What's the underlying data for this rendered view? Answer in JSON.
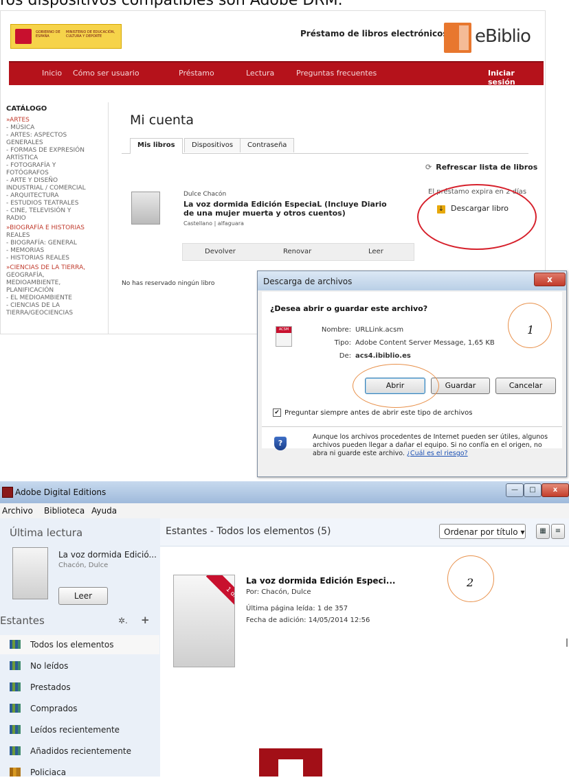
{
  "caption": "ros dispositivos compatibles son Adobe DRM.",
  "web": {
    "gov": {
      "line1": "GOBIERNO DE ESPAÑA",
      "line2": "MINISTERIO DE EDUCACIÓN, CULTURA Y DEPORTE"
    },
    "header_title": "Préstamo de libros electrónicos",
    "brand": "eBiblio",
    "nav": [
      "Inicio",
      "Cómo ser usuario",
      "Préstamo",
      "Lectura",
      "Preguntas frecuentes"
    ],
    "login": "Iniciar sesión",
    "catalog": {
      "heading": "CATÁLOGO",
      "items": [
        {
          "label": "»ARTES",
          "cat": true
        },
        {
          "label": "- MÚSICA"
        },
        {
          "label": "- ARTES: ASPECTOS"
        },
        {
          "label": "GENERALES"
        },
        {
          "label": "- FORMAS DE EXPRESIÓN"
        },
        {
          "label": "ARTÍSTICA"
        },
        {
          "label": "- FOTOGRAFÍA Y"
        },
        {
          "label": "FOTÓGRAFOS"
        },
        {
          "label": "- ARTE Y DISEÑO"
        },
        {
          "label": "INDUSTRIAL / COMERCIAL"
        },
        {
          "label": "- ARQUITECTURA"
        },
        {
          "label": "- ESTUDIOS TEATRALES"
        },
        {
          "label": "- CINE, TELEVISIÓN Y"
        },
        {
          "label": "RADIO"
        },
        {
          "label": "»BIOGRAFÍA E HISTORIAS",
          "cat": true
        },
        {
          "label": "REALES"
        },
        {
          "label": "- BIOGRAFÍA: GENERAL"
        },
        {
          "label": "- MEMORIAS"
        },
        {
          "label": "- HISTORIAS REALES"
        },
        {
          "label": "»CIENCIAS DE LA TIERRA,",
          "cat": true
        },
        {
          "label": "GEOGRAFÍA,"
        },
        {
          "label": "MEDIOAMBIENTE,"
        },
        {
          "label": "PLANIFICACIÓN"
        },
        {
          "label": "- EL MEDIOAMBIENTE"
        },
        {
          "label": "- CIENCIAS DE LA"
        },
        {
          "label": "TIERRA/GEOCIENCIAS"
        }
      ]
    },
    "page_title": "Mi cuenta",
    "tabs": [
      "Mis libros",
      "Dispositivos",
      "Contraseña"
    ],
    "refresh": "Refrescar lista de libros",
    "book": {
      "author": "Dulce Chacón",
      "title": "La voz dormida Edición EspeciaL (Incluye Diario de una mujer muerta y otros cuentos)",
      "lang": "Castellano | alfaguara"
    },
    "expire": "El préstamo expira en 2 días",
    "download": "Descargar libro",
    "actions": [
      "Devolver",
      "Renovar",
      "Leer"
    ],
    "no_reserve": "No has reservado ningún libro"
  },
  "dialog": {
    "title": "Descarga de archivos",
    "close": "x",
    "question": "¿Desea abrir o guardar este archivo?",
    "file_tag": "ACSM",
    "labels": {
      "name": "Nombre:",
      "type": "Tipo:",
      "from": "De:"
    },
    "values": {
      "name": "URLLink.acsm",
      "type": "Adobe Content Server Message, 1,65 KB",
      "from": "acs4.ibiblio.es"
    },
    "buttons": {
      "open": "Abrir",
      "save": "Guardar",
      "cancel": "Cancelar"
    },
    "checkbox": "Preguntar siempre antes de abrir este tipo de archivos",
    "warning": "Aunque los archivos procedentes de Internet pueden ser útiles, algunos archivos pueden llegar a dañar el equipo. Si no confía en el origen, no abra ni guarde este archivo.",
    "risk_link": "¿Cuál es el riesgo?",
    "marker": "1"
  },
  "ade": {
    "title": "Adobe Digital Editions",
    "menu": [
      "Archivo",
      "Biblioteca",
      "Ayuda"
    ],
    "last_read": "Última lectura",
    "lr_title": "La voz dormida Edició...",
    "lr_author": "Chacón, Dulce",
    "read_btn": "Leer",
    "shelves_heading": "Estantes",
    "shelves": [
      {
        "label": "Todos los elementos",
        "selected": true
      },
      {
        "label": "No leídos"
      },
      {
        "label": "Prestados"
      },
      {
        "label": "Comprados"
      },
      {
        "label": "Leídos recientemente"
      },
      {
        "label": "Añadidos recientemente"
      },
      {
        "label": "Policiaca",
        "gold": true
      }
    ],
    "shelf_header": "Estantes - Todos los elementos (5)",
    "sort": "Ordenar por título",
    "ribbon": "1 día",
    "book_title": "La voz dormida Edición Especi...",
    "by": "Por:  Chacón, Dulce",
    "last_page": "Última página leída:  1 de 357",
    "added": "Fecha de adición:  14/05/2014 12:56",
    "marker": "2"
  }
}
